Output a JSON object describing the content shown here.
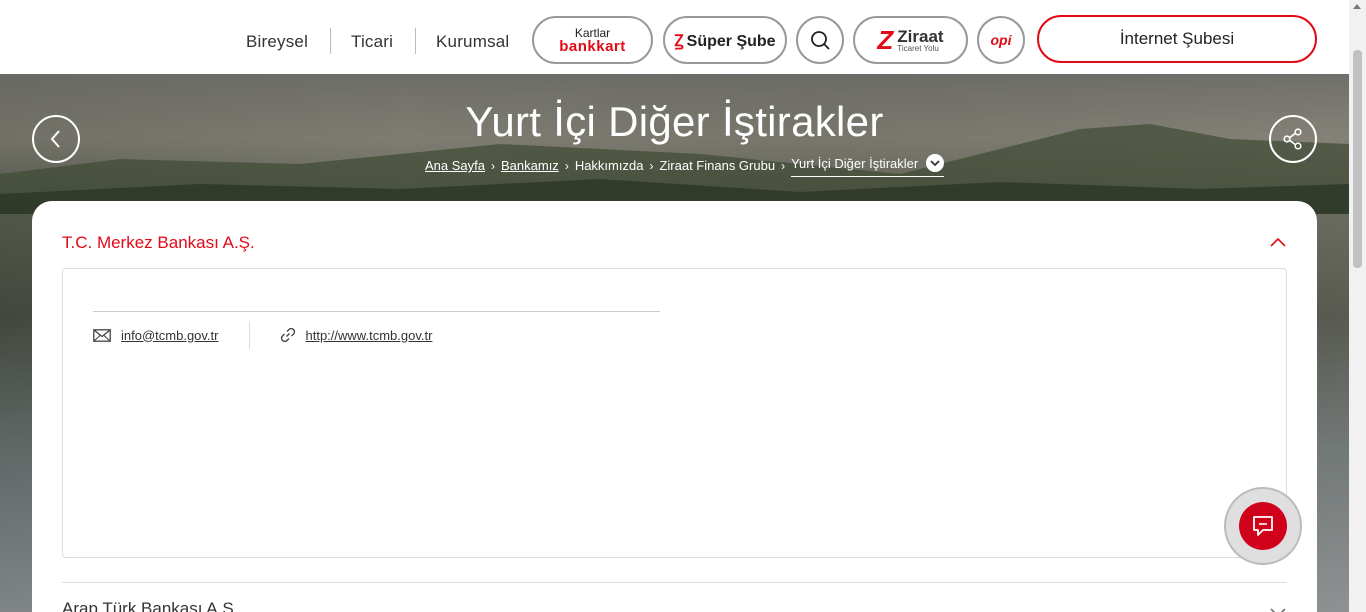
{
  "header": {
    "nav": [
      "Bireysel",
      "Ticari",
      "Kurumsal"
    ],
    "kartlar_top": "Kartlar",
    "kartlar_bottom": "bankkart",
    "super_sube": "Süper Şube",
    "ziraat_title": "Ziraat",
    "ziraat_sub": "Ticaret Yolu",
    "opi": "opi",
    "internet_subesi": "İnternet Şubesi"
  },
  "hero": {
    "title": "Yurt İçi Diğer İştirakler",
    "breadcrumb": [
      "Ana Sayfa",
      "Bankamız",
      "Hakkımızda",
      "Ziraat Finans Grubu",
      "Yurt İçi Diğer İştirakler"
    ]
  },
  "accordion": [
    {
      "title": "T.C. Merkez Bankası A.Ş.",
      "expanded": true,
      "email": "info@tcmb.gov.tr",
      "website": "http://www.tcmb.gov.tr"
    },
    {
      "title": "Arap Türk Bankası A.Ş.",
      "expanded": false
    }
  ],
  "colors": {
    "brand": "#e30a17"
  },
  "icons": [
    "search-icon",
    "back-arrow-icon",
    "share-icon",
    "mail-icon",
    "link-icon",
    "chat-icon",
    "chevron-up-icon",
    "chevron-down-icon"
  ]
}
